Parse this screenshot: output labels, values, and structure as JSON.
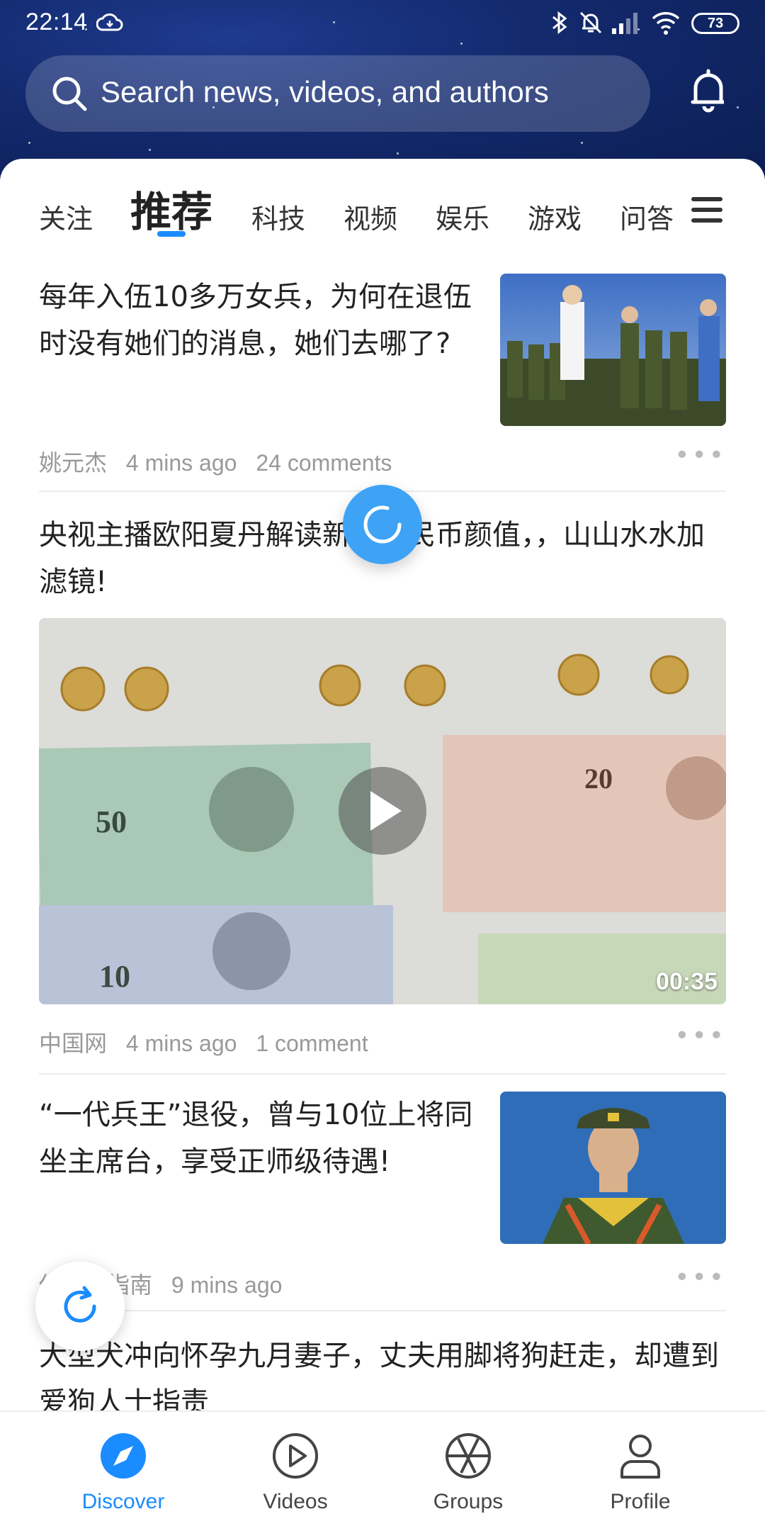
{
  "status_bar": {
    "time": "22:14",
    "battery": "73"
  },
  "search": {
    "placeholder": "Search news, videos, and authors"
  },
  "tabs": [
    {
      "label": "关注",
      "active": false
    },
    {
      "label": "推荐",
      "active": true
    },
    {
      "label": "科技",
      "active": false
    },
    {
      "label": "视频",
      "active": false
    },
    {
      "label": "娱乐",
      "active": false
    },
    {
      "label": "游戏",
      "active": false
    },
    {
      "label": "问答",
      "active": false
    }
  ],
  "articles": [
    {
      "title": "每年入伍10多万女兵，为何在退伍时没有她们的消息，她们去哪了?",
      "author": "姚元杰",
      "time": "4 mins ago",
      "comments": "24 comments"
    },
    {
      "title": "央视主播欧阳夏丹解读新版人民币颜值，，山山水水加滤镜!",
      "author": "中国网",
      "time": "4 mins ago",
      "comments": "1 comment",
      "video_duration": "00:35"
    },
    {
      "title": "“一代兵王”退役，曾与10位上将同坐主席台，享受正师级待遇!",
      "author": "佛山照指南",
      "time": "9 mins ago"
    },
    {
      "title": "大型犬冲向怀孕九月妻子，丈夫用脚将狗赶走，却遭到爱狗人士指责"
    }
  ],
  "bottom_nav": [
    {
      "label": "Discover",
      "icon": "compass-icon",
      "active": true
    },
    {
      "label": "Videos",
      "icon": "play-circle-icon",
      "active": false
    },
    {
      "label": "Groups",
      "icon": "aperture-icon",
      "active": false
    },
    {
      "label": "Profile",
      "icon": "person-icon",
      "active": false
    }
  ],
  "colors": {
    "accent": "#1a8cff",
    "header_bg": "#132a6e",
    "loading": "#3fa3f5"
  }
}
